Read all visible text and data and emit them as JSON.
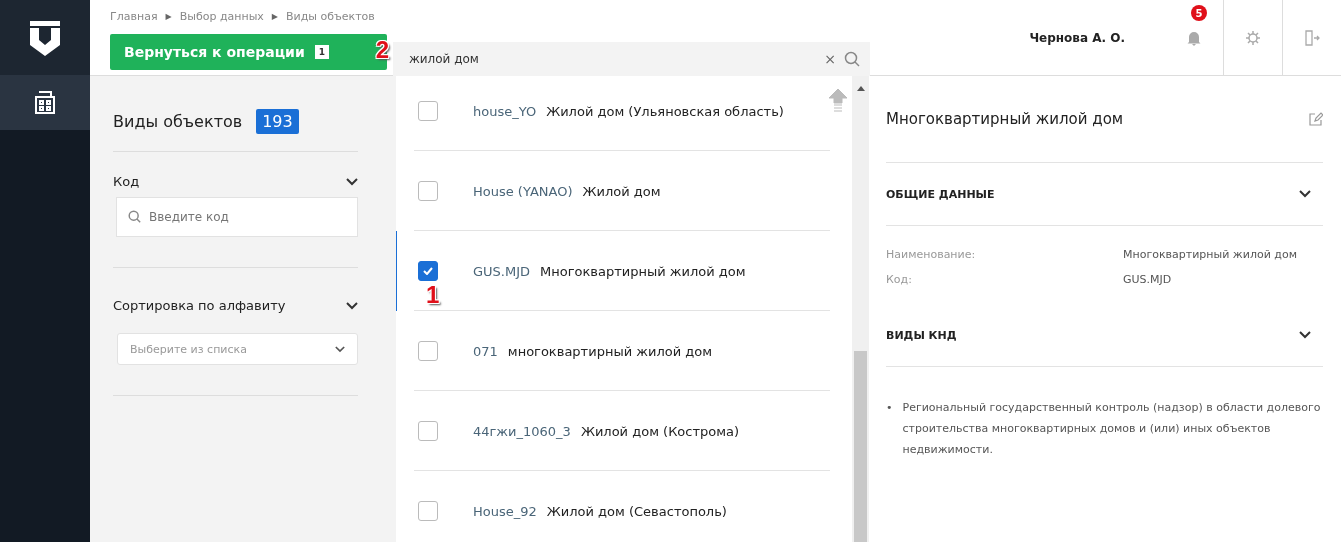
{
  "breadcrumbs": {
    "separator": "▶",
    "items": [
      "Главная",
      "Выбор данных",
      "Виды объектов"
    ]
  },
  "back_button": {
    "label": "Вернуться к операции",
    "count": "1"
  },
  "search": {
    "value": "жилой дом",
    "clear": "×"
  },
  "user": {
    "name": "Чернова А. О.",
    "notifications": "5"
  },
  "filters": {
    "title": "Виды объектов",
    "count": "193",
    "sections": [
      {
        "kind": "input",
        "label": "Код",
        "placeholder": "Введите код"
      },
      {
        "kind": "select",
        "label": "Сортировка по алфавиту",
        "placeholder": "Выберите из списка"
      }
    ]
  },
  "items": [
    {
      "code": "house_YO",
      "name": "Жилой дом (Ульяновская область)",
      "selected": false
    },
    {
      "code": "House (YANAO)",
      "name": "Жилой дом",
      "selected": false
    },
    {
      "code": "GUS.MJD",
      "name": "Многоквартирный жилой дом",
      "selected": true
    },
    {
      "code": "071",
      "name": "многоквартирный жилой дом",
      "selected": false
    },
    {
      "code": "44гжи_1060_3",
      "name": "Жилой дом (Кострома)",
      "selected": false
    },
    {
      "code": "House_92",
      "name": "Жилой дом (Севастополь)",
      "selected": false
    }
  ],
  "details": {
    "title": "Многоквартирный жилой дом",
    "sections": [
      {
        "title": "ОБЩИЕ ДАННЫЕ",
        "fields": [
          {
            "label": "Наименование:",
            "value": "Многоквартирный жилой дом"
          },
          {
            "label": "Код:",
            "value": "GUS.MJD"
          }
        ]
      },
      {
        "title": "ВИДЫ КНД",
        "bullet": "•",
        "bullets": [
          "Региональный государственный контроль (надзор) в области долевого строительства многоквартирных домов и (или) иных объектов недвижимости."
        ]
      }
    ]
  },
  "markers": [
    "1",
    "2"
  ]
}
